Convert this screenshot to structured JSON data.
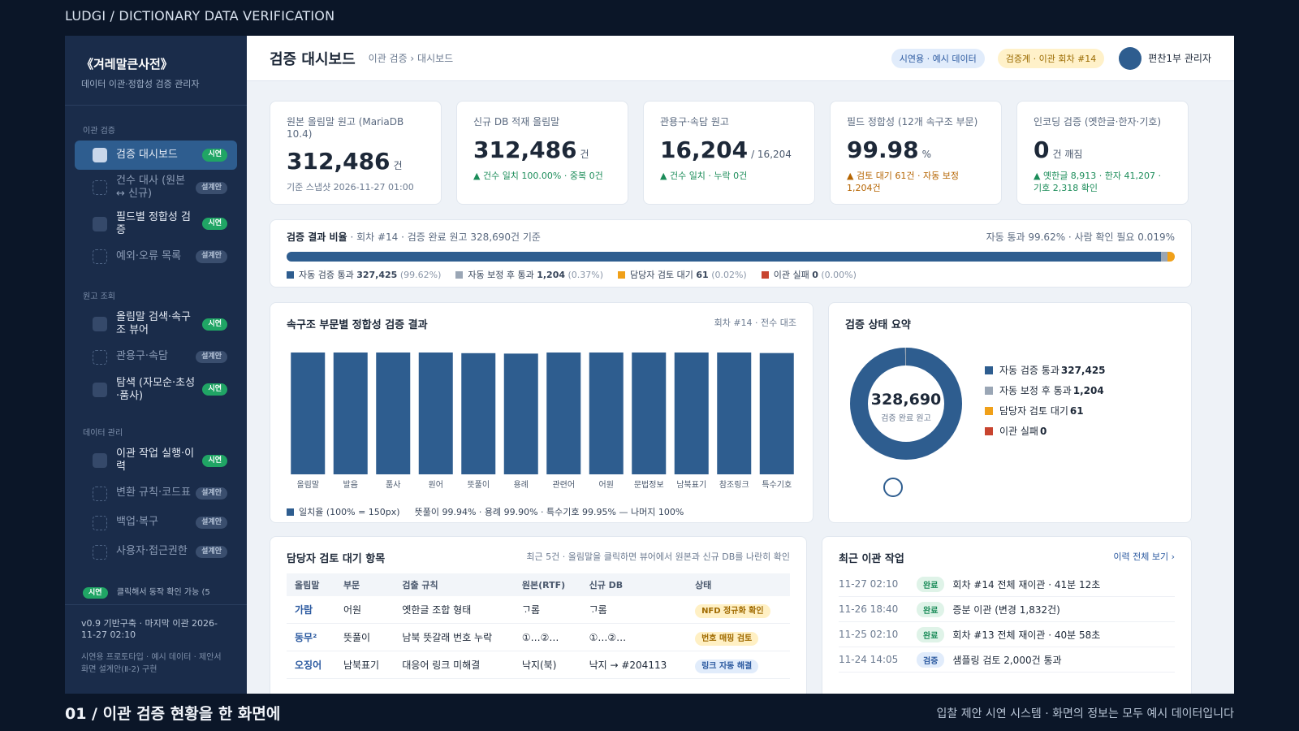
{
  "frame": {
    "title": "LUDGI / DICTIONARY DATA VERIFICATION",
    "footer_left": "01 / 이관 검증 현황을 한 화면에",
    "footer_right": "입찰 제안 시연 시스템 · 화면의 정보는 모두 예시 데이터입니다"
  },
  "sidebar": {
    "brand_title": "《겨레말큰사전》",
    "brand_subtitle": "데이터 이관·정합성 검증 관리자",
    "sections": [
      {
        "label": "이관 검증",
        "items": [
          {
            "label": "검증 대시보드",
            "badge": "시연",
            "active": true
          },
          {
            "label": "건수 대사 (원본 ↔ 신규)",
            "badge": "설계안"
          },
          {
            "label": "필드별 정합성 검증",
            "badge": "시연"
          },
          {
            "label": "예외·오류 목록",
            "badge": "설계안"
          }
        ]
      },
      {
        "label": "원고 조회",
        "items": [
          {
            "label": "올림말 검색·속구조 뷰어",
            "badge": "시연"
          },
          {
            "label": "관용구·속담",
            "badge": "설계안"
          },
          {
            "label": "탐색 (자모순·초성·품사)",
            "badge": "시연"
          }
        ]
      },
      {
        "label": "데이터 관리",
        "items": [
          {
            "label": "이관 작업 실행·이력",
            "badge": "시연"
          },
          {
            "label": "변환 규칙·코드표",
            "badge": "설계안"
          },
          {
            "label": "백업·복구",
            "badge": "설계안"
          },
          {
            "label": "사용자·접근권한",
            "badge": "설계안"
          }
        ]
      }
    ],
    "hint_badge": "시연",
    "hint_text": "클릭해서 동작 확인 가능 (5",
    "footer_version": "v0.9 기반구축 · 마지막 이관 2026-11-27 02:10",
    "footer_note": "시연용 프로토타입 · 예시 데이터 · 제안서 화면 설계안(Ⅱ-2) 구현"
  },
  "header": {
    "title": "검증 대시보드",
    "breadcrumb": "이관 검증 › 대시보드",
    "chip_demo": "시연용 · 예시 데이터",
    "chip_round": "검증계 · 이관 회차 #14",
    "admin": "편찬1부 관리자"
  },
  "kpis": [
    {
      "label": "원본 올림말 원고 (MariaDB 10.4)",
      "value": "312,486",
      "unit": "건",
      "note": "기준 스냅샷 2026-11-27 01:00",
      "tone": "gy"
    },
    {
      "label": "신규 DB 적재 올림말",
      "value": "312,486",
      "unit": "건",
      "note": "▲ 건수 일치 100.00% · 중복 0건",
      "tone": "gr"
    },
    {
      "label": "관용구·속담 원고",
      "value": "16,204",
      "unit": "/ 16,204",
      "note": "▲ 건수 일치 · 누락 0건",
      "tone": "gr"
    },
    {
      "label": "필드 정합성 (12개 속구조 부문)",
      "value": "99.98",
      "unit": "%",
      "note": "▲ 검토 대기 61건 · 자동 보정 1,204건",
      "tone": "or"
    },
    {
      "label": "인코딩 검증 (옛한글·한자·기호)",
      "value": "0",
      "unit": "건 깨짐",
      "note": "▲ 옛한글 8,913 · 한자 41,207 · 기호 2,318 확인",
      "tone": "gr"
    }
  ],
  "ratio": {
    "title": "검증 결과 비율",
    "subtitle": "· 회차 #14 · 검증 완료 원고 328,690건 기준",
    "right": "자동 통과 99.62% · 사람 확인 필요 0.019%",
    "segments": [
      {
        "label": "자동 검증 통과",
        "count": "327,425",
        "pct": "(99.62%)",
        "share": 99.62,
        "color": "#2e5d8f"
      },
      {
        "label": "자동 보정 후 통과",
        "count": "1,204",
        "pct": "(0.37%)",
        "share": 0.37,
        "color": "#9aa6b5"
      },
      {
        "label": "담당자 검토 대기",
        "count": "61",
        "pct": "(0.02%)",
        "share": 0.02,
        "color": "#f0a019"
      },
      {
        "label": "이관 실패",
        "count": "0",
        "pct": "(0.00%)",
        "share": 0,
        "color": "#c8442f"
      }
    ]
  },
  "chart_data": {
    "type": "bar",
    "title": "속구조 부문별 정합성 검증 결과",
    "subtitle": "회차 #14 · 전수 대조",
    "categories": [
      "올림말",
      "발음",
      "품사",
      "원어",
      "뜻풀이",
      "용례",
      "관련어",
      "어원",
      "문법정보",
      "남북표기",
      "참조링크",
      "특수기호"
    ],
    "values": [
      100,
      100,
      100,
      100,
      99.94,
      99.9,
      100,
      100,
      100,
      100,
      100,
      99.95
    ],
    "ylim": [
      0,
      100
    ],
    "color": "#2e5d8f",
    "legend": "일치율 (100% = 150px)",
    "legend_note": "뜻풀이 99.94% · 용례 99.90% · 특수기호 99.95% — 나머지 100%"
  },
  "status": {
    "title": "검증 상태 요약",
    "center_value": "328,690",
    "center_label": "검증 완료 원고",
    "items": [
      {
        "label": "자동 검증 통과",
        "count": "327,425",
        "color": "#2e5d8f"
      },
      {
        "label": "자동 보정 후 통과",
        "count": "1,204",
        "color": "#9aa6b5"
      },
      {
        "label": "담당자 검토 대기",
        "count": "61",
        "color": "#f0a019"
      },
      {
        "label": "이관 실패",
        "count": "0",
        "color": "#c8442f"
      }
    ]
  },
  "review": {
    "title": "담당자 검토 대기 항목",
    "note": "최근 5건 · 올림말을 클릭하면 뷰어에서 원본과 신규 DB를 나란히 확인",
    "columns": [
      "올림말",
      "부문",
      "검출 규칙",
      "원본(RTF)",
      "신규 DB",
      "상태"
    ],
    "rows": [
      {
        "word": "가람",
        "part": "어원",
        "rule": "옛한글 조합 형태",
        "src": "ᄀᆞ롬",
        "dst": "ᄀᆞ롬",
        "status": "NFD 정규화 확인"
      },
      {
        "word": "동무²",
        "part": "뜻풀이",
        "rule": "남북 뜻갈래 번호 누락",
        "src": "①…②…",
        "dst": "①…②…",
        "status": "번호 매핑 검토"
      },
      {
        "word": "오징어",
        "part": "남북표기",
        "rule": "대응어 링크 미해결",
        "src": "낙지(북)",
        "dst": "낙지 → #204113",
        "status": "링크 자동 해결"
      }
    ]
  },
  "jobs": {
    "title": "최근 이관 작업",
    "link": "이력 전체 보기 ›",
    "rows": [
      {
        "time": "11-27 02:10",
        "badge": "완료",
        "text": "회차 #14 전체 재이관 · 41분 12초"
      },
      {
        "time": "11-26 18:40",
        "badge": "완료",
        "text": "증분 이관 (변경 1,832건)"
      },
      {
        "time": "11-25 02:10",
        "badge": "완료",
        "text": "회차 #13 전체 재이관 · 40분 58초"
      },
      {
        "time": "11-24 14:05",
        "badge": "검증",
        "text": "샘플링 검토 2,000건 통과"
      }
    ]
  }
}
